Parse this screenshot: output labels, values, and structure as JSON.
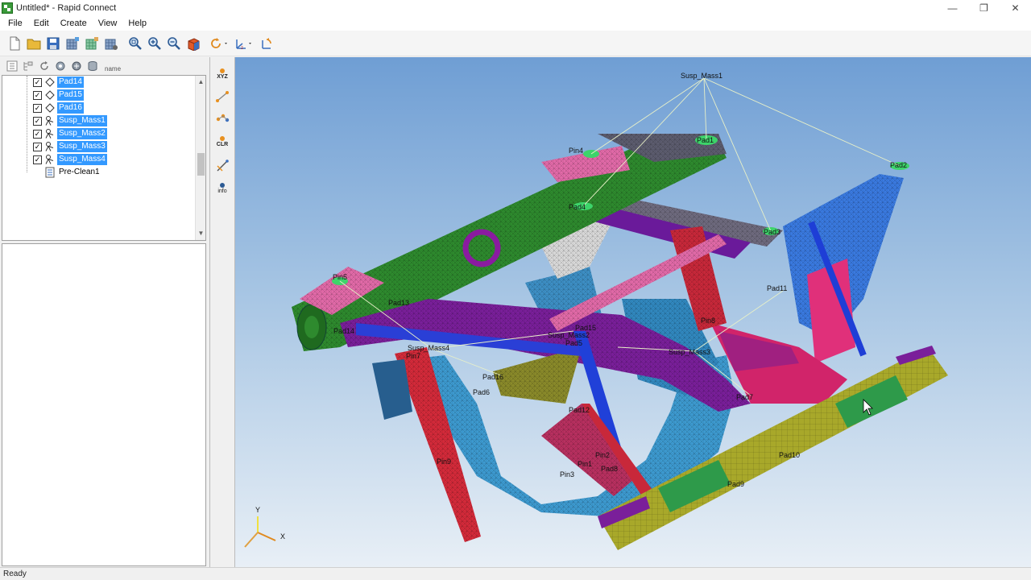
{
  "window": {
    "title": "Untitled* - Rapid Connect"
  },
  "menu": [
    "File",
    "Edit",
    "Create",
    "View",
    "Help"
  ],
  "tree_toolbar": {
    "name_label": "name"
  },
  "tree": [
    {
      "label": "Pad14",
      "selected": true,
      "checked": true,
      "icon": "pad-icon"
    },
    {
      "label": "Pad15",
      "selected": true,
      "checked": true,
      "icon": "pad-icon"
    },
    {
      "label": "Pad16",
      "selected": true,
      "checked": true,
      "icon": "pad-icon"
    },
    {
      "label": "Susp_Mass1",
      "selected": true,
      "checked": true,
      "icon": "mass-icon"
    },
    {
      "label": "Susp_Mass2",
      "selected": true,
      "checked": true,
      "icon": "mass-icon"
    },
    {
      "label": "Susp_Mass3",
      "selected": true,
      "checked": true,
      "icon": "mass-icon"
    },
    {
      "label": "Susp_Mass4",
      "selected": true,
      "checked": true,
      "icon": "mass-icon"
    },
    {
      "label": "Pre-Clean1",
      "selected": false,
      "checked": false,
      "icon": "list-icon"
    }
  ],
  "side_tools": [
    {
      "label": "XYZ",
      "icon": "xyz-icon"
    },
    {
      "label": "",
      "icon": "line-icon"
    },
    {
      "label": "",
      "icon": "nodes-icon"
    },
    {
      "label": "CLR",
      "icon": "clear-icon"
    },
    {
      "label": "",
      "icon": "measure-icon"
    },
    {
      "label": "info",
      "icon": "info-icon"
    }
  ],
  "model_labels": {
    "susp_mass1": "Susp_Mass1",
    "susp_mass2": "Susp_Mass2",
    "susp_mass3": "Susp_Mass3",
    "susp_mass4": "Susp_Mass4",
    "pad1": "Pad1",
    "pad2": "Pad2",
    "pad3": "Pad3",
    "pad4": "Pad4",
    "pad5": "Pad5",
    "pad6": "Pad6",
    "pad7": "Pad7",
    "pad8": "Pad8",
    "pad9": "Pad9",
    "pad10": "Pad10",
    "pad11": "Pad11",
    "pad12": "Pad12",
    "pad13": "Pad13",
    "pad14": "Pad14",
    "pad15": "Pad15",
    "pad16": "Pad16",
    "pin1": "Pin1",
    "pin2": "Pin2",
    "pin3": "Pin3",
    "pin4": "Pin4",
    "pin5": "Pin5",
    "pin7": "Pin7",
    "pin8": "Pin8",
    "pin9": "Pin9"
  },
  "axes": {
    "x": "X",
    "y": "Y"
  },
  "colors": {
    "selection": "#3399ff",
    "rail_green": "#2e8a2e",
    "pink": "#e0559a",
    "blue": "#2a5ad8",
    "red": "#d42a3a",
    "olive": "#a8a82a",
    "cyan": "#3d9ad0",
    "purple": "#7a1f9a"
  },
  "status": "Ready"
}
